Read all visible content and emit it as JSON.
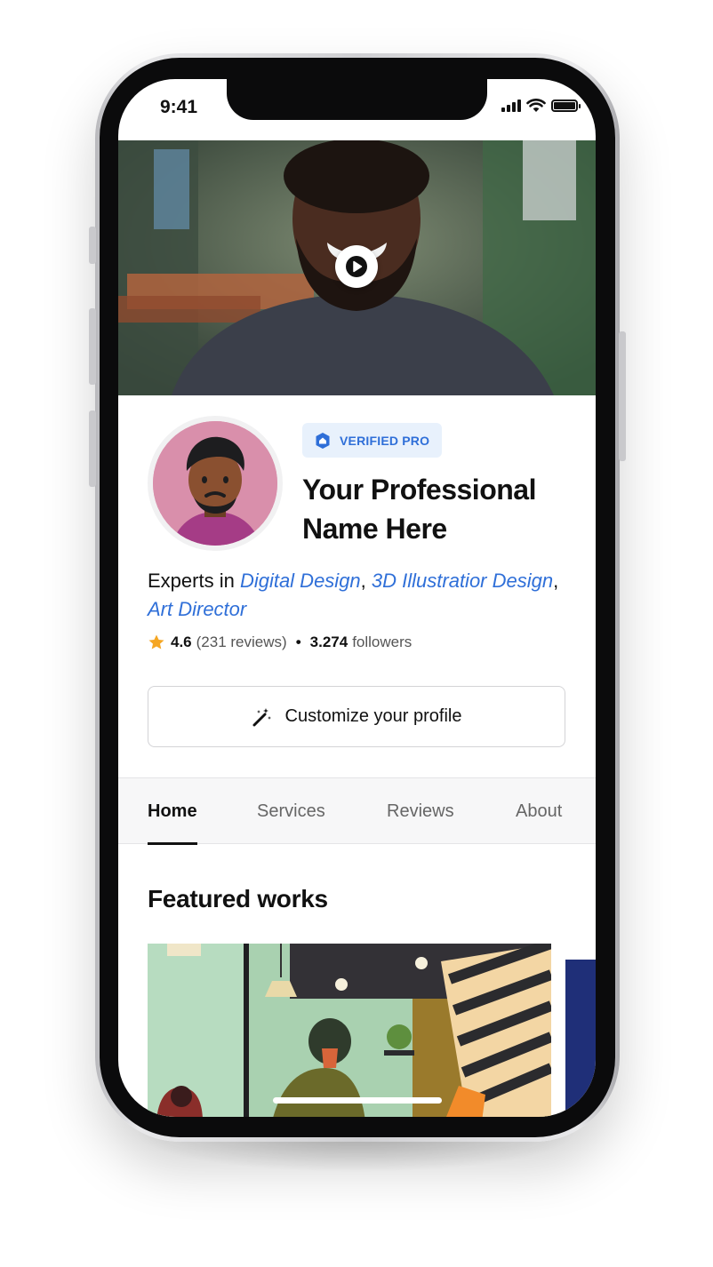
{
  "status_bar": {
    "time": "9:41"
  },
  "hero": {
    "play_icon": "play-icon"
  },
  "profile": {
    "badge": "VERIFIED PRO",
    "name_line1": "Your Professional",
    "name_line2": "Name Here",
    "expert_prefix": "Experts in ",
    "skills": [
      "Digital Design",
      "3D Illustratior Design",
      "Art Director"
    ],
    "comma": ", ",
    "rating": "4.6",
    "reviews": "(231 reviews)",
    "separator": "•",
    "followers_count": "3.274",
    "followers_label": "followers",
    "customize_label": "Customize your profile"
  },
  "tabs": [
    {
      "label": "Home"
    },
    {
      "label": "Services"
    },
    {
      "label": "Reviews"
    },
    {
      "label": "About"
    }
  ],
  "featured": {
    "title": "Featured works"
  },
  "colors": {
    "accent": "#2f6fd8",
    "badge_bg": "#e8f1fc",
    "star": "#f5a623"
  }
}
